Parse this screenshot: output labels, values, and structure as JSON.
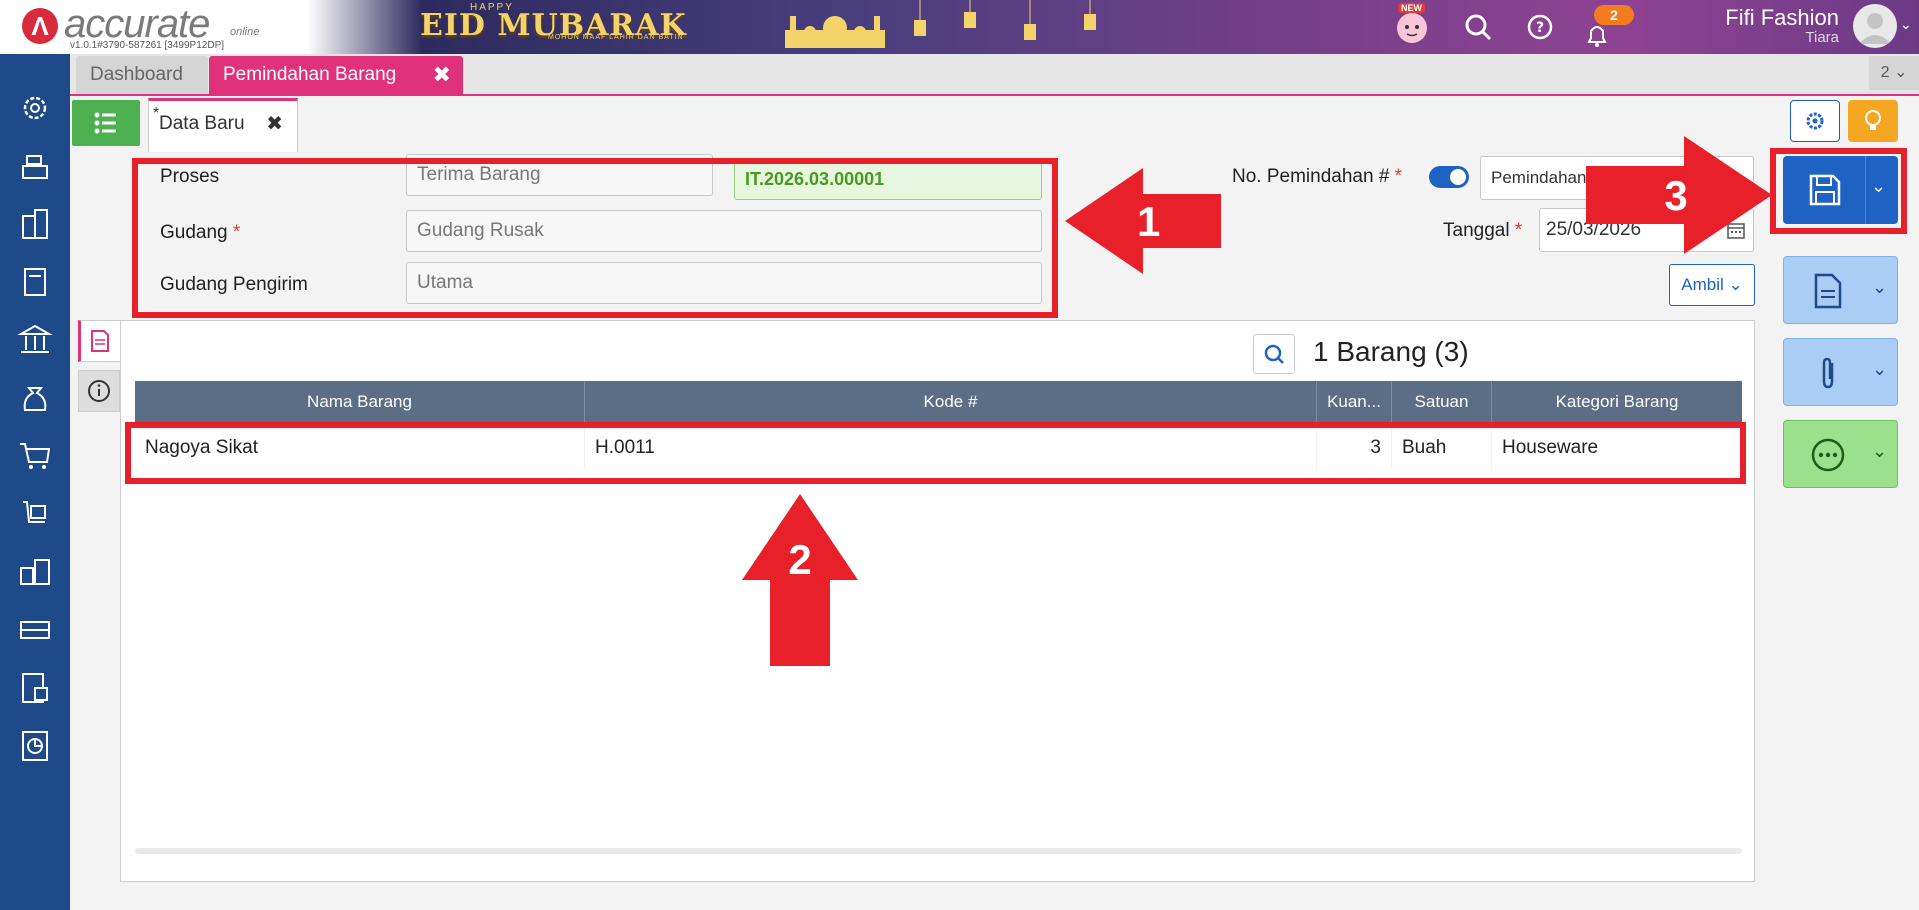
{
  "header": {
    "brand": "accurate",
    "brand_suffix": "online",
    "version": "v1.0.1#3790-587261 [3499P12DP]",
    "banner_small": "HAPPY",
    "banner_title": "EID MUBARAK",
    "banner_sub": "MOHON MAAF LAHIR DAN BATIN",
    "new_badge": "NEW",
    "notification_count": "2",
    "company": "Fifi Fashion",
    "user": "Tiara",
    "icons": [
      "new-feature-icon",
      "search-icon",
      "help-icon",
      "bell-icon",
      "avatar"
    ]
  },
  "sidebar": {
    "icons": [
      "gear-icon",
      "cash-register-icon",
      "building-icon",
      "ledger-book-icon",
      "bank-icon",
      "money-bag-icon",
      "cart-icon",
      "purchase-cart-icon",
      "inventory-icon",
      "factory-icon",
      "tax-icon",
      "report-chart-icon"
    ]
  },
  "tabs": {
    "dashboard": "Dashboard",
    "active": "Pemindahan Barang",
    "close": "✖",
    "count": "2"
  },
  "subtab": {
    "star": "*",
    "label": "Data Baru",
    "close": "✖"
  },
  "form": {
    "proses_label": "Proses",
    "proses_value": "Terima Barang",
    "ref_number": "IT.2026.03.00001",
    "gudang_label": "Gudang",
    "gudang_value": "Gudang Rusak",
    "pengirim_label": "Gudang Pengirim",
    "pengirim_value": "Utama",
    "no_label": "No. Pemindahan #",
    "no_select": "Pemindahan",
    "tanggal_label": "Tanggal",
    "tanggal_value": "25/03/2026",
    "required_mark": "*",
    "ambil": "Ambil"
  },
  "grid": {
    "title": "1 Barang (3)",
    "columns": [
      "Nama Barang",
      "Kode #",
      "Kuan...",
      "Satuan",
      "Kategori Barang"
    ],
    "rows": [
      {
        "nama": "Nagoya Sikat",
        "kode": "H.0011",
        "kuantitas": "3",
        "satuan": "Buah",
        "kategori": "Houseware"
      }
    ]
  },
  "annotations": {
    "one": "1",
    "two": "2",
    "three": "3",
    "color": "#e8202a"
  },
  "colors": {
    "accent": "#e0327a",
    "primary": "#1e63c4",
    "sidebar": "#1e4a89"
  }
}
